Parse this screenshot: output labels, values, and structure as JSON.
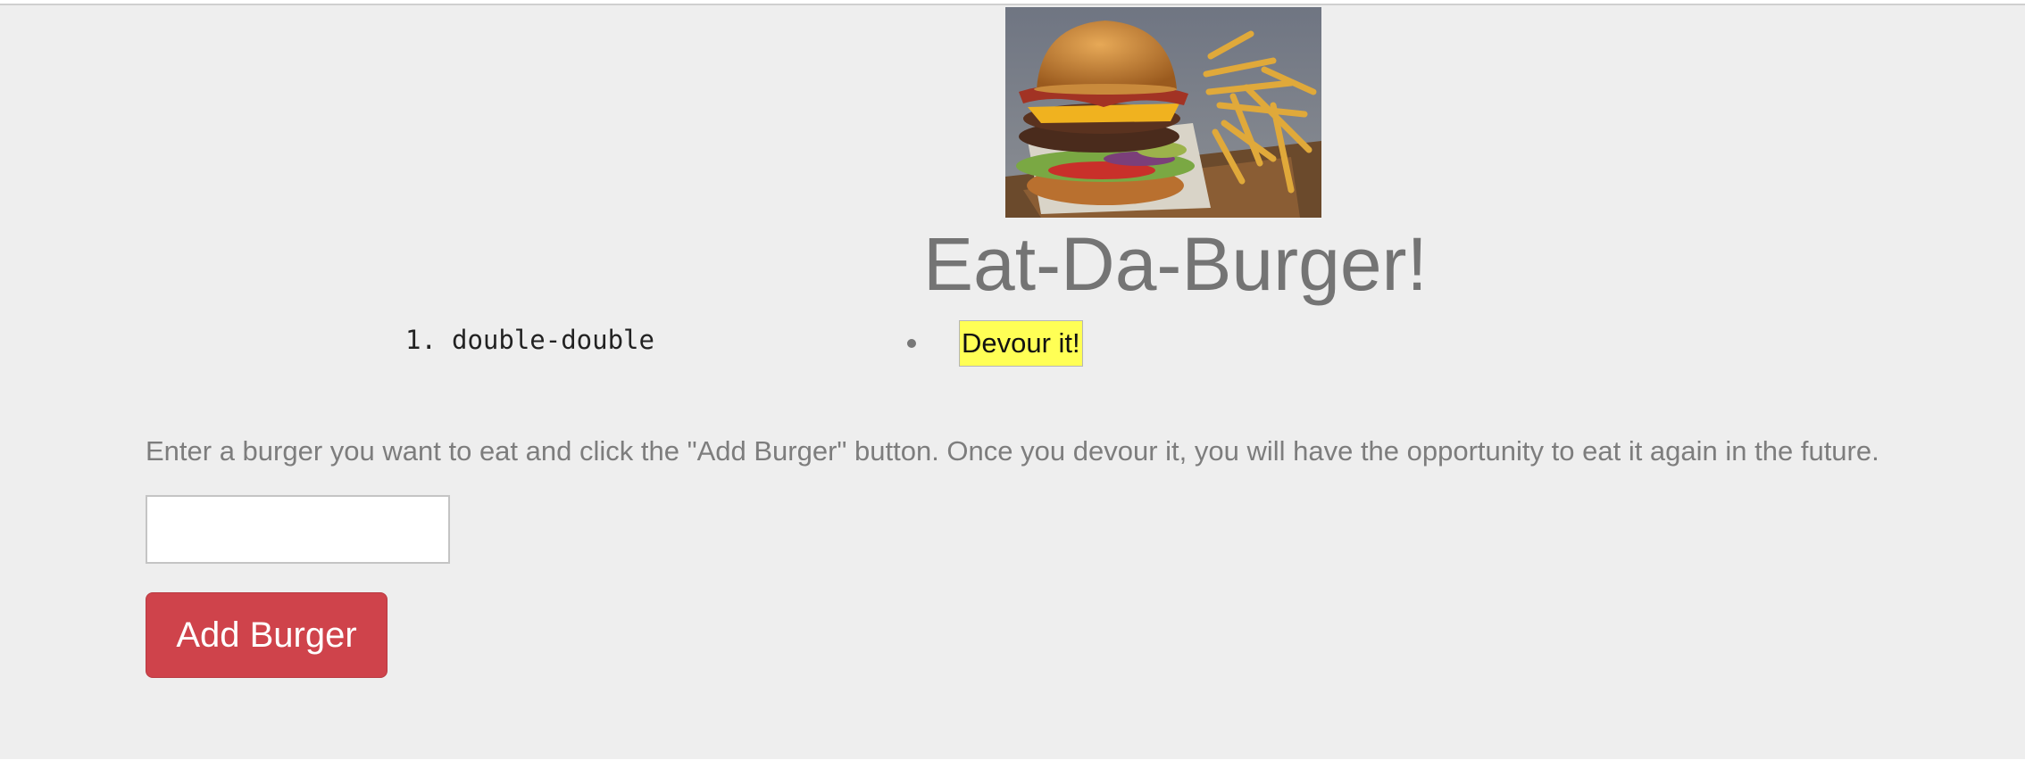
{
  "header": {
    "image_alt": "burger-image",
    "title": "Eat-Da-Burger!"
  },
  "burgers": [
    {
      "number": "1.",
      "name": "double-double"
    }
  ],
  "devour": {
    "button_label": "Devour it!",
    "button_color": "#ffff55"
  },
  "form": {
    "instructions": "Enter a burger you want to eat and click the \"Add Burger\" button. Once you devour it, you will have the opportunity to eat it again in the future.",
    "input_value": "",
    "submit_label": "Add Burger",
    "submit_color": "#cf434b"
  },
  "colors": {
    "page_background": "#eeeeee",
    "text_gray": "#747474"
  }
}
